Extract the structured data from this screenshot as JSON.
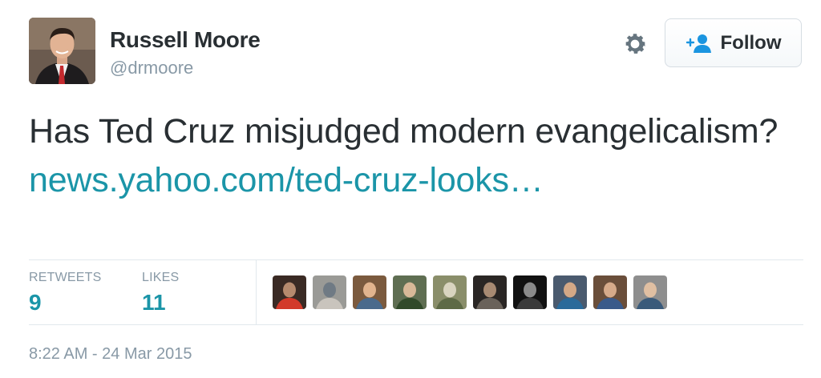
{
  "author": {
    "name": "Russell Moore",
    "handle": "@drmoore"
  },
  "actions": {
    "settings_icon": "gear-icon",
    "follow_icon": "add-user-icon",
    "follow_label": "Follow"
  },
  "tweet": {
    "text": "Has Ted Cruz misjudged modern evangelicalism? ",
    "link_text": "news.yahoo.com/ted-cruz-looks…"
  },
  "stats": {
    "retweets_label": "RETWEETS",
    "retweets_count": "9",
    "likes_label": "LIKES",
    "likes_count": "11"
  },
  "likers": [
    {
      "colors": [
        "#3a2a24",
        "#b68a6e",
        "#d23a2a"
      ]
    },
    {
      "colors": [
        "#9a9a96",
        "#6f7a84",
        "#c9c4bd"
      ]
    },
    {
      "colors": [
        "#7b5a3e",
        "#e2b48e",
        "#4a6a8c"
      ]
    },
    {
      "colors": [
        "#5f6e52",
        "#d8b898",
        "#314a2a"
      ]
    },
    {
      "colors": [
        "#8a8e6a",
        "#d9d4c0",
        "#5e6a46"
      ]
    },
    {
      "colors": [
        "#2a2624",
        "#a88a72",
        "#6a625a"
      ]
    },
    {
      "colors": [
        "#111111",
        "#8a8a8a",
        "#3a3a3a"
      ]
    },
    {
      "colors": [
        "#4a5a6e",
        "#d4a886",
        "#2a6a9a"
      ]
    },
    {
      "colors": [
        "#6a4e3a",
        "#d6aa8a",
        "#3a5a8a"
      ]
    },
    {
      "colors": [
        "#8e8e8e",
        "#e0bfa2",
        "#3a5a7a"
      ]
    }
  ],
  "timestamp": "8:22 AM - 24 Mar 2015",
  "colors": {
    "link": "#1b95a8",
    "muted": "#8899a6",
    "text": "#292f33",
    "divider": "#e1e8ed"
  }
}
